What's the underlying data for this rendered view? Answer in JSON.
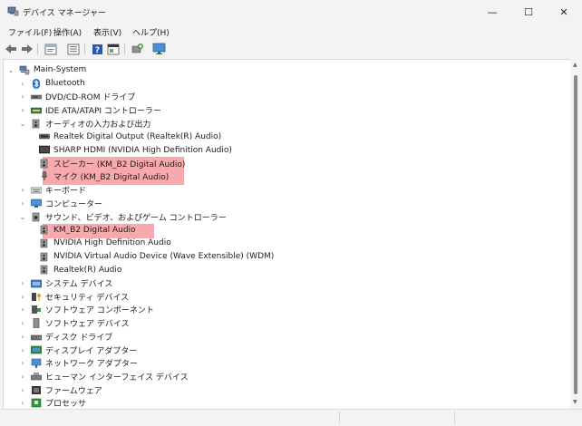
{
  "window": {
    "title": "デバイス マネージャー",
    "minimize_glyph": "—",
    "maximize_glyph": "☐",
    "close_glyph": "✕"
  },
  "menu": [
    "ファイル(F)",
    "操作(A)",
    "表示(V)",
    "ヘルプ(H)"
  ],
  "toolbar": [
    "back-arrow-icon",
    "forward-arrow-icon",
    "properties-icon",
    "device-list-icon",
    "help-icon",
    "details-icon",
    "update-driver-icon",
    "monitor-icon"
  ],
  "tree": {
    "root": "Main-System",
    "items": [
      {
        "label": "Bluetooth",
        "chevron": "›",
        "icon": "bluetooth-icon"
      },
      {
        "label": "DVD/CD-ROM ドライブ",
        "chevron": "›",
        "icon": "dvd-drive-icon"
      },
      {
        "label": "IDE ATA/ATAPI コントローラー",
        "chevron": "›",
        "icon": "ide-controller-icon"
      },
      {
        "label": "オーディオの入力および出力",
        "chevron": "⌄",
        "icon": "speaker-icon"
      },
      {
        "label": "Realtek Digital Output (Realtek(R) Audio)",
        "chevron": "",
        "icon": "digital-output-icon"
      },
      {
        "label": "SHARP HDMI (NVIDIA High Definition Audio)",
        "chevron": "",
        "icon": "hdmi-monitor-icon"
      },
      {
        "label": "スピーカー (KM_B2 Digital Audio)",
        "chevron": "",
        "icon": "speaker-icon"
      },
      {
        "label": "マイク (KM_B2 Digital Audio)",
        "chevron": "",
        "icon": "microphone-icon"
      },
      {
        "label": "キーボード",
        "chevron": "›",
        "icon": "keyboard-icon"
      },
      {
        "label": "コンピューター",
        "chevron": "›",
        "icon": "computer-icon"
      },
      {
        "label": "サウンド、ビデオ、およびゲーム コントローラー",
        "chevron": "⌄",
        "icon": "sound-controller-icon"
      },
      {
        "label": "KM_B2 Digital Audio",
        "chevron": "",
        "icon": "speaker-icon"
      },
      {
        "label": "NVIDIA High Definition Audio",
        "chevron": "",
        "icon": "speaker-icon"
      },
      {
        "label": "NVIDIA Virtual Audio Device (Wave Extensible) (WDM)",
        "chevron": "",
        "icon": "speaker-icon"
      },
      {
        "label": "Realtek(R) Audio",
        "chevron": "",
        "icon": "speaker-icon"
      },
      {
        "label": "システム デバイス",
        "chevron": "›",
        "icon": "system-device-icon"
      },
      {
        "label": "セキュリティ デバイス",
        "chevron": "›",
        "icon": "security-key-icon"
      },
      {
        "label": "ソフトウェア コンポーネント",
        "chevron": "›",
        "icon": "software-component-icon"
      },
      {
        "label": "ソフトウェア デバイス",
        "chevron": "›",
        "icon": "software-device-icon"
      },
      {
        "label": "ディスク ドライブ",
        "chevron": "›",
        "icon": "disk-drive-icon"
      },
      {
        "label": "ディスプレイ アダプター",
        "chevron": "›",
        "icon": "display-adapter-icon"
      },
      {
        "label": "ネットワーク アダプター",
        "chevron": "›",
        "icon": "network-adapter-icon"
      },
      {
        "label": "ヒューマン インターフェイス デバイス",
        "chevron": "›",
        "icon": "hid-icon"
      },
      {
        "label": "ファームウェア",
        "chevron": "›",
        "icon": "firmware-icon"
      },
      {
        "label": "プロセッサ",
        "chevron": "›",
        "icon": "processor-icon"
      }
    ]
  },
  "highlight_color": "#f7a9ad"
}
